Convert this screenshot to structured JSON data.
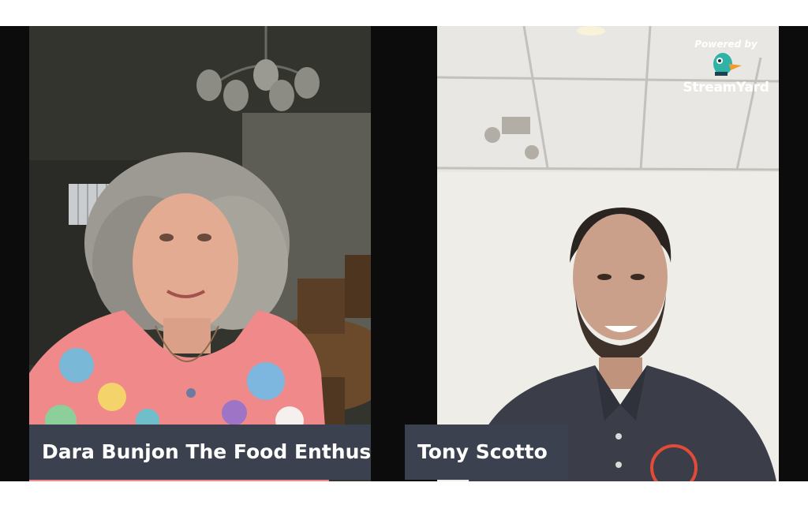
{
  "participants": [
    {
      "name": "Dara Bunjon The Food Enthusi..."
    },
    {
      "name": "Tony Scotto"
    }
  ],
  "branding": {
    "powered_by": "Powered by",
    "product": "StreamYard",
    "icon": "duck-logo-icon"
  },
  "colors": {
    "nameplate_bg": "#3c4150",
    "nameplate_text": "#ffffff",
    "stage_bg": "#0c0c0c"
  }
}
